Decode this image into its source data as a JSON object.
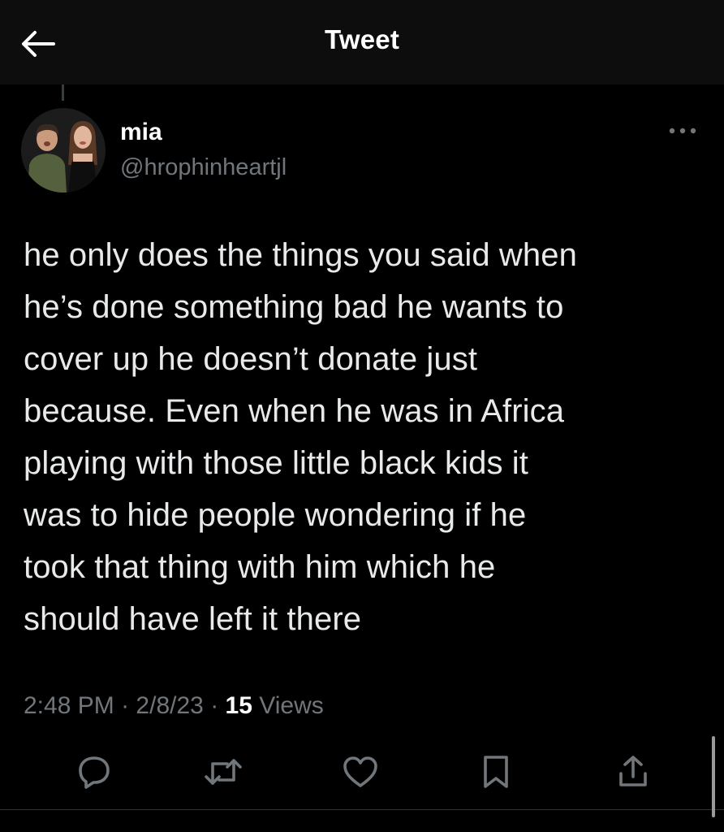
{
  "header": {
    "title": "Tweet",
    "back_icon": "arrow-left-icon"
  },
  "author": {
    "name": "mia",
    "handle": "@hrophinheartjl",
    "avatar": "profile-photo"
  },
  "tweet": {
    "text": "he only does the things you said when\nhe’s done something bad he wants to\ncover up he doesn’t donate just\nbecause. Even when he was in Africa\nplaying with those little black kids it\nwas to hide people wondering if he\ntook that thing with him which he\nshould have left it there",
    "time": "2:48 PM",
    "separator": "·",
    "date": "2/8/23",
    "views_count": "15",
    "views_label": "Views"
  },
  "actions": [
    {
      "name": "reply",
      "icon": "reply-icon"
    },
    {
      "name": "retweet",
      "icon": "retweet-icon"
    },
    {
      "name": "like",
      "icon": "heart-icon"
    },
    {
      "name": "bookmark",
      "icon": "bookmark-icon"
    },
    {
      "name": "share",
      "icon": "share-icon"
    }
  ],
  "colors": {
    "background": "#000000",
    "text": "#e7e9ea",
    "secondary": "#71767b",
    "divider": "#2f3336"
  }
}
